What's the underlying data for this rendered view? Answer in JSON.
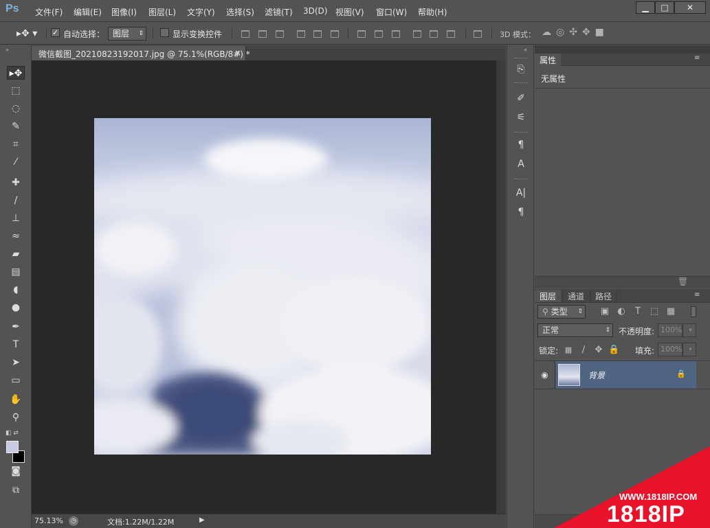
{
  "app": {
    "logo": "Ps"
  },
  "menu": [
    "文件(F)",
    "编辑(E)",
    "图像(I)",
    "图层(L)",
    "文字(Y)",
    "选择(S)",
    "滤镜(T)",
    "3D(D)",
    "视图(V)",
    "窗口(W)",
    "帮助(H)"
  ],
  "window_controls": {
    "minimize": "▁",
    "maximize": "□",
    "close": "✕"
  },
  "options": {
    "auto_select_label": "自动选择：",
    "auto_select_value": "图层",
    "show_transform_label": "显示变换控件",
    "mode_3d_label": "3D 模式："
  },
  "document": {
    "tab_title": "微信截图_20210823192017.jpg @ 75.1%(RGB/8#) *",
    "zoom": "75.13%",
    "doc_size": "文档:1.22M/1.22M"
  },
  "properties": {
    "tab": "属性",
    "empty_text": "无属性"
  },
  "layers_panel": {
    "tabs": [
      "图层",
      "通道",
      "路径"
    ],
    "filter_type": "类型",
    "blend_mode": "正常",
    "opacity_label": "不透明度:",
    "opacity_value": "100%",
    "lock_label": "锁定:",
    "fill_label": "填充:",
    "fill_value": "100%",
    "layer_name": "背景"
  },
  "watermark": {
    "url": "WWW.1818IP.COM",
    "brand": "1818IP"
  },
  "colors": {
    "ui_bg": "#535353",
    "canvas_bg": "#282828",
    "selected_layer": "#4f6480",
    "watermark_red": "#e8132b"
  }
}
